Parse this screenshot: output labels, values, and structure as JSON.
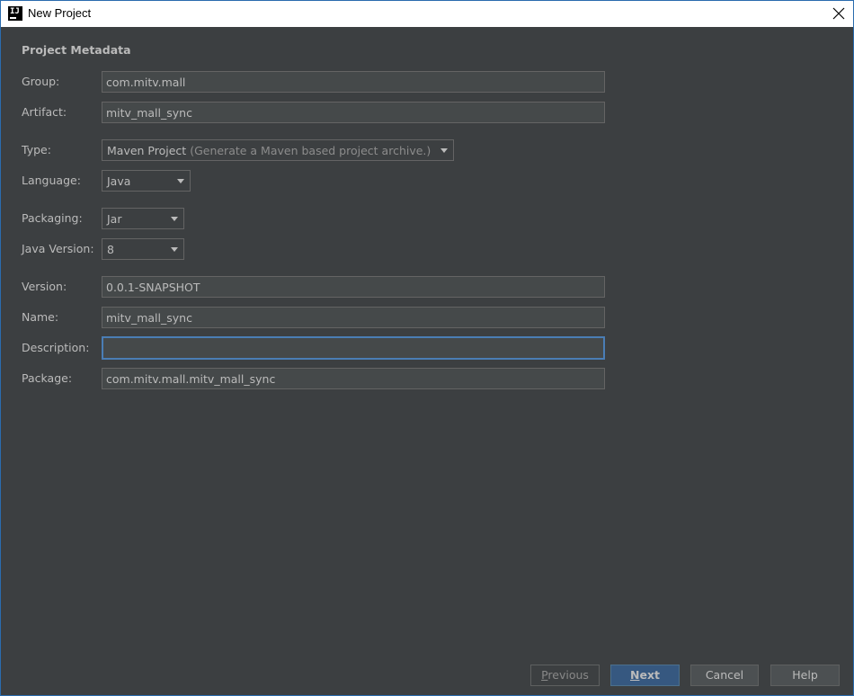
{
  "window": {
    "title": "New Project",
    "app_icon_text": "IJ"
  },
  "section": {
    "title": "Project Metadata"
  },
  "fields": {
    "group": {
      "label": "Group:",
      "value": "com.mitv.mall"
    },
    "artifact": {
      "label": "Artifact:",
      "value": "mitv_mall_sync"
    },
    "type": {
      "label": "Type:",
      "value": "Maven Project",
      "hint": "(Generate a Maven based project archive.)"
    },
    "language": {
      "label": "Language:",
      "value": "Java"
    },
    "packaging": {
      "label": "Packaging:",
      "value": "Jar"
    },
    "java_version": {
      "label": "Java Version:",
      "value": "8"
    },
    "version": {
      "label": "Version:",
      "value": "0.0.1-SNAPSHOT"
    },
    "name": {
      "label": "Name:",
      "value": "mitv_mall_sync"
    },
    "description": {
      "label": "Description:",
      "value": ""
    },
    "package": {
      "label": "Package:",
      "value": "com.mitv.mall.mitv_mall_sync"
    }
  },
  "buttons": {
    "previous": {
      "mnemonic": "P",
      "rest": "revious",
      "enabled": false
    },
    "next": {
      "mnemonic": "N",
      "rest": "ext"
    },
    "cancel": {
      "label": "Cancel"
    },
    "help": {
      "label": "Help"
    }
  },
  "icons": {
    "app": "intellij-icon",
    "close": "close-icon",
    "dropdown": "chevron-down-icon"
  },
  "colors": {
    "background": "#3c3f41",
    "field_background": "#45494a",
    "focus_border": "#4a7db5",
    "default_button": "#365880",
    "text": "#bbbbbb"
  }
}
